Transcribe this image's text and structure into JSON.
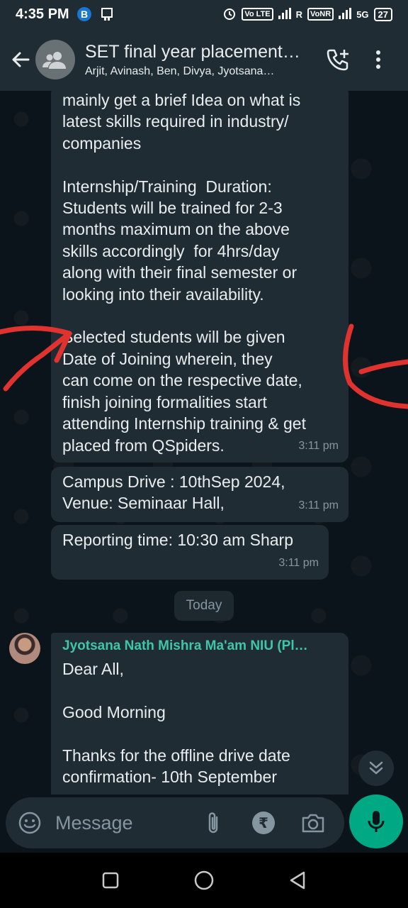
{
  "status_bar": {
    "time": "4:35 PM",
    "vo_lte": "Vo LTE",
    "r_label": "R",
    "vonr": "VoNR",
    "network": "5G",
    "battery": "27"
  },
  "header": {
    "title": "SET final year placement…",
    "subtitle": "Arjit, Avinash, Ben, Divya, Jyotsana…"
  },
  "messages": [
    {
      "text": "mainly get a brief Idea on what is\nlatest skills required in industry/\ncompanies\n\nInternship/Training  Duration:\nStudents will be trained for 2-3\nmonths maximum on the above\nskills accordingly  for 4hrs/day\nalong with their final semester or\nlooking into their availability.\n\nSelected students will be given\nDate of Joining wherein, they\ncan come on the respective date,\nfinish joining formalities start\nattending Internship training & get\nplaced from QSpiders.",
      "time": "3:11 pm"
    },
    {
      "text": "Campus Drive : 10thSep 2024,\nVenue: Seminaar Hall,",
      "time": "3:11 pm"
    },
    {
      "text": "Reporting time: 10:30 am Sharp",
      "time": "3:11 pm"
    }
  ],
  "date_divider": "Today",
  "incoming": {
    "sender": "Jyotsana Nath Mishra Ma'am NIU (Pl…",
    "text": "Dear All,\n\nGood Morning\n\nThanks for the offline drive date\nconfirmation- 10th September"
  },
  "input": {
    "placeholder": "Message"
  },
  "colors": {
    "accent": "#00a884",
    "bubble": "#202c33",
    "background": "#0b141a",
    "annotation": "#e0322e"
  }
}
